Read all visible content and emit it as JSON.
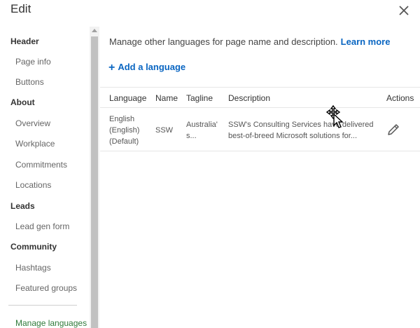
{
  "dialog": {
    "title": "Edit",
    "close_icon": "close-icon"
  },
  "sidebar": {
    "sections": [
      {
        "heading": "Header",
        "items": [
          "Page info",
          "Buttons"
        ]
      },
      {
        "heading": "About",
        "items": [
          "Overview",
          "Workplace",
          "Commitments",
          "Locations"
        ]
      },
      {
        "heading": "Leads",
        "items": [
          "Lead gen form"
        ]
      },
      {
        "heading": "Community",
        "items": [
          "Hashtags",
          "Featured groups"
        ]
      }
    ],
    "active_item": "Manage languages"
  },
  "main": {
    "intro_text": "Manage other languages for page name and description.",
    "learn_more": "Learn more",
    "add_language": "Add a language",
    "table": {
      "headers": [
        "Language",
        "Name",
        "Tagline",
        "Description",
        "Actions"
      ],
      "rows": [
        {
          "language_line1": "English",
          "language_line2": "(English)",
          "language_line3": "(Default)",
          "name": "SSW",
          "tagline_line1": "Australia'",
          "tagline_line2": "s...",
          "description_line1": "SSW's Consulting Services have delivered",
          "description_line2": "best-of-breed Microsoft solutions for...",
          "action_icon": "pencil-icon"
        }
      ]
    }
  },
  "colors": {
    "link": "#0a66c2",
    "active_nav": "#2f7a3a"
  }
}
